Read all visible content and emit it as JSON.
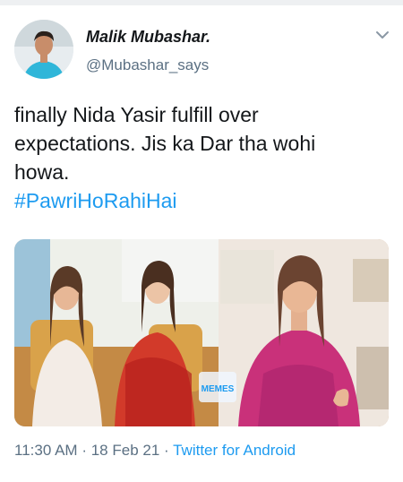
{
  "tweet": {
    "author_name": "Malik Mubashar.",
    "author_handle": "@Mubashar_says",
    "text_lines": [
      "finally Nida Yasir fulfill over",
      "expectations. Jis ka Dar tha wohi",
      "howa."
    ],
    "hashtag": "#PawriHoRahiHai",
    "media_watermark": "MEMES",
    "time": "11:30 AM",
    "date": "18 Feb 21",
    "separator": "·",
    "source": "Twitter for Android"
  },
  "icons": {
    "menu": "chevron-down-icon"
  },
  "colors": {
    "link": "#1d9bf0",
    "secondary_text": "#5b7083"
  }
}
